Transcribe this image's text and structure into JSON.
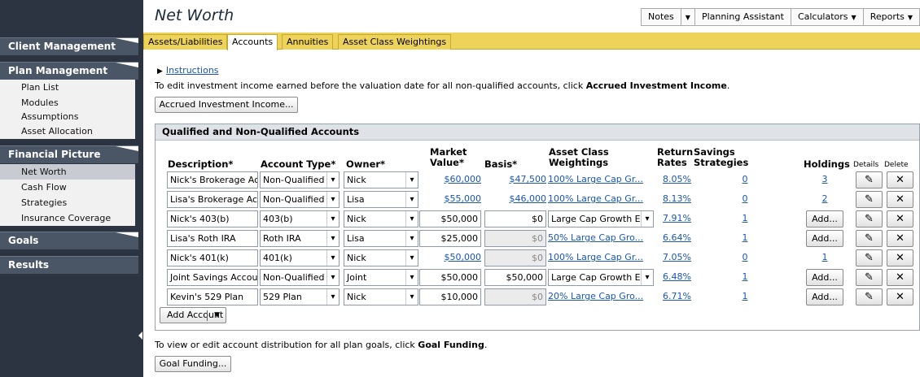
{
  "sidebar": {
    "sections": [
      {
        "label": "Client Management"
      },
      {
        "label": "Plan Management",
        "items": [
          "Plan List",
          "Modules",
          "Assumptions",
          "Asset Allocation"
        ]
      },
      {
        "label": "Financial Picture",
        "items": [
          "Net Worth",
          "Cash Flow",
          "Strategies",
          "Insurance Coverage"
        ]
      },
      {
        "label": "Goals"
      },
      {
        "label": "Results"
      }
    ],
    "active_item": "Net Worth"
  },
  "header": {
    "title": "Net Worth",
    "toolbar": [
      "Notes",
      "Planning Assistant",
      "Calculators",
      "Reports"
    ]
  },
  "tabs": [
    "Assets/Liabilities",
    "Accounts",
    "Annuities",
    "Asset Class Weightings"
  ],
  "active_tab": "Accounts",
  "content": {
    "instructions_link": "Instructions",
    "info_prefix": "To edit investment income earned before the valuation date for all non-qualified accounts, click ",
    "info_bold": "Accrued Investment Income",
    "info_suffix": ".",
    "accrued_button": "Accrued Investment Income...",
    "panel_title": "Qualified and Non-Qualified Accounts",
    "columns": {
      "description": "Description*",
      "account_type": "Account Type*",
      "owner": "Owner*",
      "market_value_1": "Market",
      "market_value_2": "Value*",
      "basis": "Basis*",
      "acw_1": "Asset Class",
      "acw_2": "Weightings",
      "return_1": "Return",
      "return_2": "Rates",
      "savings_1": "Savings",
      "savings_2": "Strategies",
      "holdings": "Holdings",
      "details": "Details",
      "delete": "Delete"
    },
    "rows": [
      {
        "description": "Nick's Brokerage Acc",
        "account_type": "Non-Qualified",
        "owner": "Nick",
        "market_value": "$60,000",
        "basis": "$47,500",
        "acw": "100% Large Cap Gr...",
        "return_rate": "8.05%",
        "savings": "0",
        "holdings": "3"
      },
      {
        "description": "Lisa's Brokerage Acc",
        "account_type": "Non-Qualified",
        "owner": "Lisa",
        "market_value": "$55,000",
        "basis": "$46,000",
        "acw": "100% Large Cap Gr...",
        "return_rate": "8.13%",
        "savings": "0",
        "holdings": "2"
      },
      {
        "description": "Nick's 403(b)",
        "account_type": "403(b)",
        "owner": "Nick",
        "market_value": "$50,000",
        "basis": "$0",
        "acw": "Large Cap Growth E",
        "return_rate": "7.91%",
        "savings": "1",
        "holdings": "Add..."
      },
      {
        "description": "Lisa's Roth IRA",
        "account_type": "Roth IRA",
        "owner": "Lisa",
        "market_value": "$25,000",
        "basis": "$0",
        "acw": "50% Large Cap Gro...",
        "return_rate": "6.64%",
        "savings": "1",
        "holdings": "Add..."
      },
      {
        "description": "Nick's 401(k)",
        "account_type": "401(k)",
        "owner": "Nick",
        "market_value": "$50,000",
        "basis": "$0",
        "acw": "100% Large Cap Gr...",
        "return_rate": "7.05%",
        "savings": "0",
        "holdings": "1"
      },
      {
        "description": "Joint Savings Accou",
        "account_type": "Non-Qualified",
        "owner": "Joint",
        "market_value": "$50,000",
        "basis": "$50,000",
        "acw": "Large Cap Growth E",
        "return_rate": "6.48%",
        "savings": "1",
        "holdings": "Add..."
      },
      {
        "description": "Kevin's 529 Plan",
        "account_type": "529 Plan",
        "owner": "Nick",
        "market_value": "$10,000",
        "basis": "$0",
        "acw": "20% Large Cap Gro...",
        "return_rate": "6.71%",
        "savings": "1",
        "holdings": "Add..."
      }
    ],
    "add_account_button": "Add Account",
    "goal_info_prefix": "To view or edit account distribution for all plan goals, click ",
    "goal_info_bold": "Goal Funding",
    "goal_info_suffix": ".",
    "goal_button": "Goal Funding..."
  },
  "icons": {
    "details": "edit-note-icon",
    "delete": "close-x-icon",
    "dropdown": "chevron-down-icon"
  }
}
